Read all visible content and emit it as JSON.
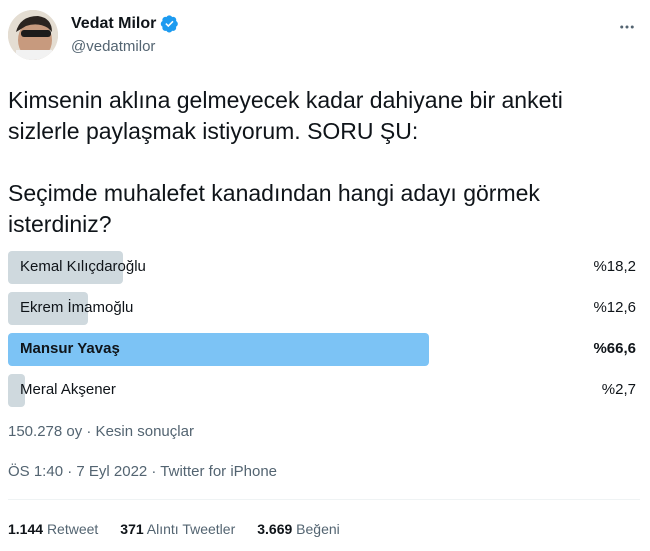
{
  "author": {
    "display_name": "Vedat Milor",
    "handle": "@vedatmilor",
    "verified_color": "#1d9bf0",
    "avatar_icon": "profile-photo"
  },
  "tweet": {
    "text": "Kimsenin aklına gelmeyecek kadar dahiyane bir anketi sizlerle paylaşmak istiyorum. SORU ŞU:\n\nSeçimde muhalefet kanadından hangi adayı görmek isterdiniz?"
  },
  "poll": {
    "options": [
      {
        "label": "Kemal Kılıçdaroğlu",
        "percent_text": "%18,2",
        "percent": 18.2,
        "winner": false
      },
      {
        "label": "Ekrem İmamoğlu",
        "percent_text": "%12,6",
        "percent": 12.6,
        "winner": false
      },
      {
        "label": "Mansur Yavaş",
        "percent_text": "%66,6",
        "percent": 66.6,
        "winner": true
      },
      {
        "label": "Meral Akşener",
        "percent_text": "%2,7",
        "percent": 2.7,
        "winner": false
      }
    ],
    "meta": "150.278 oy · Kesin sonuçlar",
    "bar_color": "#cfd9de",
    "winner_bar_color": "#7cc3f5"
  },
  "timestamp": "ÖS 1:40 · 7 Eyl 2022 · Twitter for iPhone",
  "stats": {
    "retweets_count": "1.144",
    "retweets_label": "Retweet",
    "quotes_count": "371",
    "quotes_label": "Alıntı Tweetler",
    "likes_count": "3.669",
    "likes_label": "Beğeni"
  }
}
